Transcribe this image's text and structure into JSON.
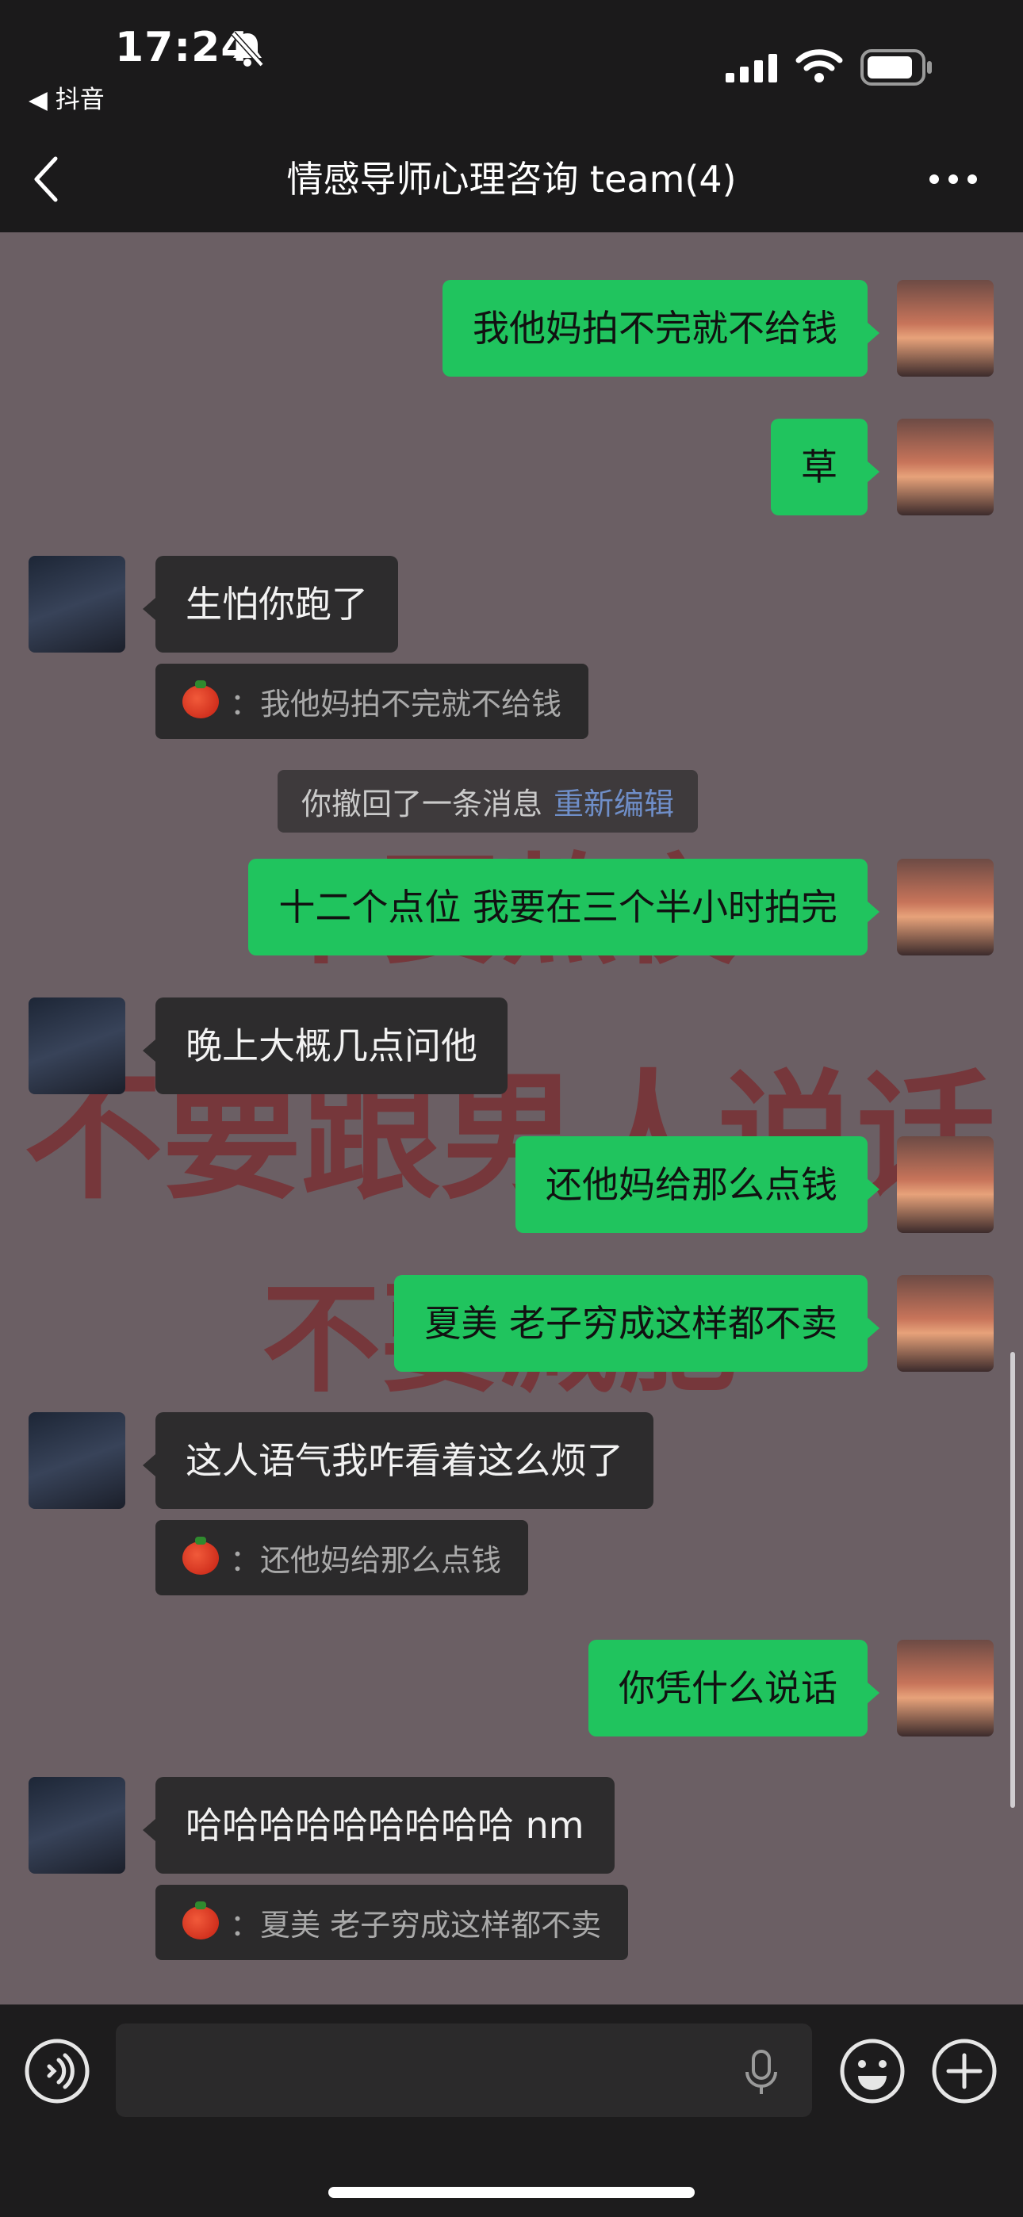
{
  "status_bar": {
    "time": "17:24",
    "back_app": "◀ 抖音"
  },
  "nav": {
    "title": "情感导师心理咨询 team(4)"
  },
  "watermark": {
    "line1": "不要熬夜",
    "line2": "不要跟男人说话",
    "line3": "不要减肥"
  },
  "messages": [
    {
      "from": "me",
      "text": "我他妈拍不完就不给钱"
    },
    {
      "from": "me",
      "text": "草"
    },
    {
      "from": "other",
      "text": "生怕你跑了",
      "quote": "我他妈拍不完就不给钱"
    },
    {
      "system": "你撤回了一条消息",
      "link": "重新编辑"
    },
    {
      "from": "me",
      "text": "十二个点位 我要在三个半小时拍完"
    },
    {
      "from": "other",
      "text": "晚上大概几点问他"
    },
    {
      "from": "me",
      "text": "还他妈给那么点钱"
    },
    {
      "from": "me",
      "text": "夏美 老子穷成这样都不卖"
    },
    {
      "from": "other",
      "text": "这人语气我咋看着这么烦了",
      "quote": "还他妈给那么点钱"
    },
    {
      "from": "me",
      "text": "你凭什么说话"
    },
    {
      "from": "other",
      "text": "哈哈哈哈哈哈哈哈哈 nm",
      "quote": "夏美 老子穷成这样都不卖"
    }
  ],
  "quote_sep": "：",
  "colors": {
    "my_bubble": "#20c45e",
    "other_bubble": "#2d2c2d",
    "chat_background": "#6b5f64",
    "watermark": "#7a2a2e",
    "link": "#6f8ec8"
  },
  "icons": [
    "bell-off-icon",
    "signal-icon",
    "wifi-icon",
    "battery-icon",
    "back-chevron-icon",
    "more-icon",
    "voice-icon",
    "mic-icon",
    "emoji-icon",
    "plus-icon",
    "tomato-icon"
  ]
}
